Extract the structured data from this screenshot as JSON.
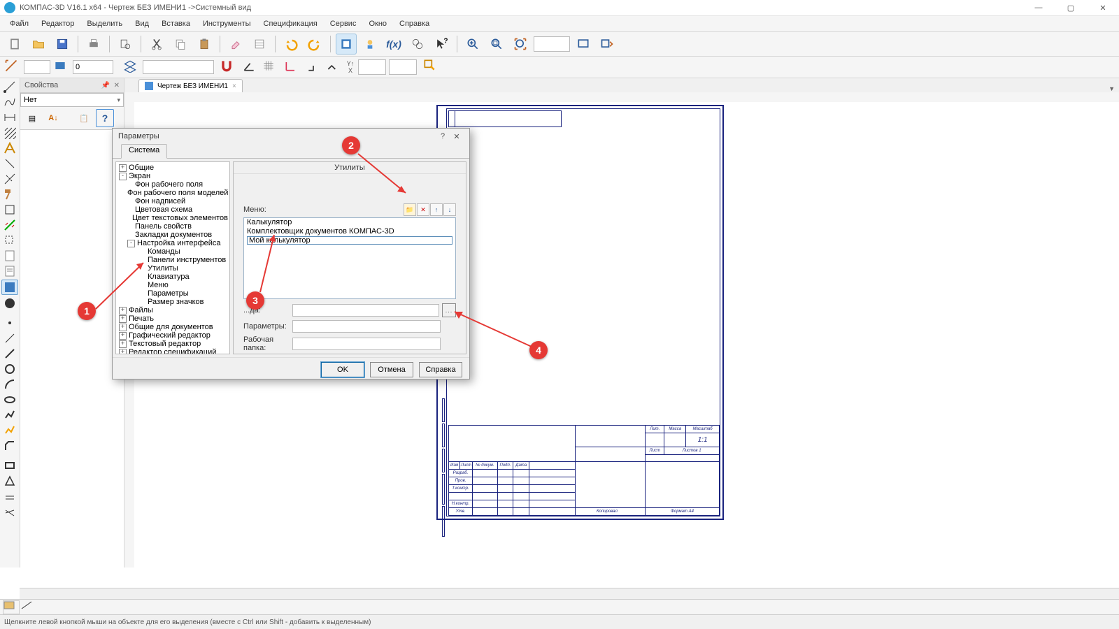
{
  "app_title": "КОМПАС-3D V16.1 x64 - Чертеж БЕЗ ИМЕНИ1 ->Системный вид",
  "menus": [
    "Файл",
    "Редактор",
    "Выделить",
    "Вид",
    "Вставка",
    "Инструменты",
    "Спецификация",
    "Сервис",
    "Окно",
    "Справка"
  ],
  "props_panel": {
    "title": "Свойства",
    "value": "Нет"
  },
  "doc_tab": "Чертеж БЕЗ ИМЕНИ1",
  "dialog": {
    "title": "Параметры",
    "tab": "Система",
    "pane_title": "Утилиты",
    "tree": [
      {
        "l": 0,
        "exp": "+",
        "t": "Общие"
      },
      {
        "l": 0,
        "exp": "-",
        "t": "Экран"
      },
      {
        "l": 1,
        "exp": "",
        "t": "Фон рабочего поля"
      },
      {
        "l": 1,
        "exp": "",
        "t": "Фон рабочего поля моделей"
      },
      {
        "l": 1,
        "exp": "",
        "t": "Фон надписей"
      },
      {
        "l": 1,
        "exp": "",
        "t": "Цветовая схема"
      },
      {
        "l": 1,
        "exp": "",
        "t": "Цвет текстовых элементов"
      },
      {
        "l": 1,
        "exp": "",
        "t": "Панель свойств"
      },
      {
        "l": 1,
        "exp": "",
        "t": "Закладки документов"
      },
      {
        "l": 1,
        "exp": "-",
        "t": "Настройка интерфейса"
      },
      {
        "l": 2,
        "exp": "",
        "t": "Команды"
      },
      {
        "l": 2,
        "exp": "",
        "t": "Панели инструментов"
      },
      {
        "l": 2,
        "exp": "",
        "t": "Утилиты"
      },
      {
        "l": 2,
        "exp": "",
        "t": "Клавиатура"
      },
      {
        "l": 2,
        "exp": "",
        "t": "Меню"
      },
      {
        "l": 2,
        "exp": "",
        "t": "Параметры"
      },
      {
        "l": 2,
        "exp": "",
        "t": "Размер значков"
      },
      {
        "l": 0,
        "exp": "+",
        "t": "Файлы"
      },
      {
        "l": 0,
        "exp": "+",
        "t": "Печать"
      },
      {
        "l": 0,
        "exp": "+",
        "t": "Общие для документов"
      },
      {
        "l": 0,
        "exp": "+",
        "t": "Графический редактор"
      },
      {
        "l": 0,
        "exp": "+",
        "t": "Текстовый редактор"
      },
      {
        "l": 0,
        "exp": "+",
        "t": "Редактор спецификаций"
      }
    ],
    "menu_label": "Меню:",
    "menu_items": [
      "Калькулятор",
      "Комплектовщик документов КОМПАС-3D"
    ],
    "menu_editing": "Мой калькулятор",
    "fields": {
      "command": {
        "label": "...да:",
        "value": ""
      },
      "params": {
        "label": "Параметры:",
        "value": ""
      },
      "workdir": {
        "label": "Рабочая папка:",
        "value": ""
      }
    },
    "buttons": {
      "ok": "OK",
      "cancel": "Отмена",
      "help": "Справка"
    }
  },
  "drawing": {
    "page_num": "1:1",
    "kopiroval": "Копировал",
    "format": "Формат    А4",
    "tb_labels": [
      "Изм",
      "Лист",
      "№ докум.",
      "Подп.",
      "Дата",
      "Разраб.",
      "Пров.",
      "Т.контр.",
      "Н.контр.",
      "Утв.",
      "Лит.",
      "Масса",
      "Масштаб",
      "Лист",
      "Листов   1"
    ]
  },
  "annotations": {
    "a1": "1",
    "a2": "2",
    "a3": "3",
    "a4": "4"
  },
  "statusbar": "Щелкните левой кнопкой мыши на объекте для его выделения (вместе с Ctrl или Shift - добавить к выделенным)"
}
